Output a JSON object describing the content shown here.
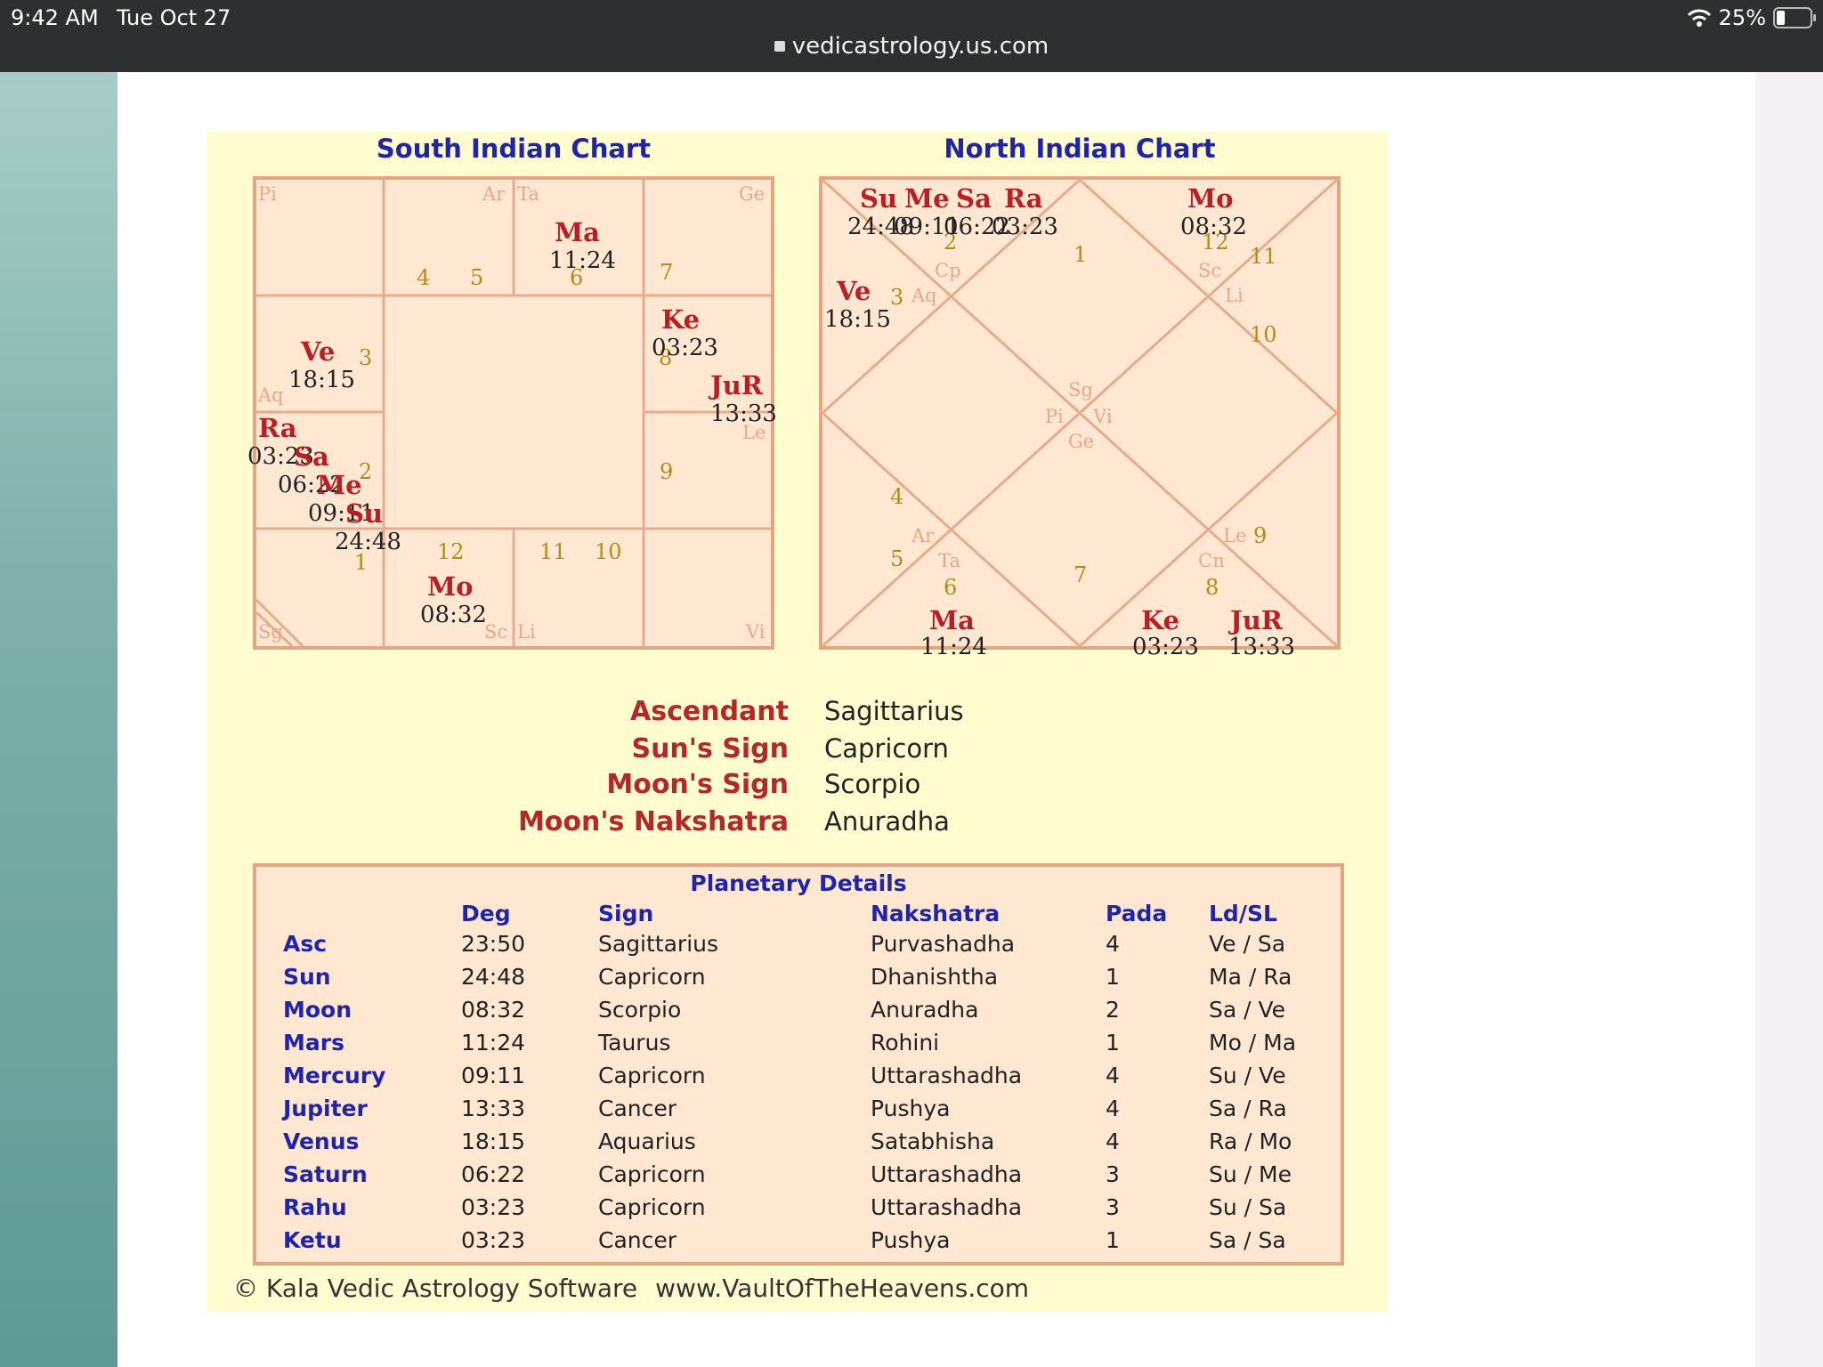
{
  "status_bar": {
    "time": "9:42 AM",
    "date": "Tue Oct 27",
    "battery": "25%",
    "url": "vedicastrology.us.com"
  },
  "south_chart": {
    "title": "South Indian Chart",
    "signs": {
      "pi": "Pi",
      "ar": "Ar",
      "ta": "Ta",
      "ge": "Ge",
      "aq": "Aq",
      "le": "Le",
      "sg": "Sg",
      "sc": "Sc",
      "li": "Li",
      "vi": "Vi"
    },
    "numbers": {
      "n4": "4",
      "n5": "5",
      "n6": "6",
      "n7": "7",
      "n3": "3",
      "n2": "2",
      "n1": "1",
      "n12": "12",
      "n11": "11",
      "n10": "10",
      "n9": "9",
      "n8": "8"
    },
    "planets": {
      "ma": {
        "name": "Ma",
        "deg": "11:24"
      },
      "ke": {
        "name": "Ke",
        "deg": "03:23"
      },
      "jur": {
        "name": "JuR",
        "deg": "13:33"
      },
      "ve": {
        "name": "Ve",
        "deg": "18:15"
      },
      "ra": {
        "name": "Ra",
        "deg": "03:23"
      },
      "sa": {
        "name": "Sa",
        "deg": "06:22"
      },
      "me": {
        "name": "Me",
        "deg": "09:11"
      },
      "su": {
        "name": "Su",
        "deg": "24:48"
      },
      "mo": {
        "name": "Mo",
        "deg": "08:32"
      }
    }
  },
  "north_chart": {
    "title": "North Indian Chart",
    "signs": {
      "cp": "Cp",
      "aq": "Aq",
      "sc": "Sc",
      "li": "Li",
      "sg": "Sg",
      "pi": "Pi",
      "vi": "Vi",
      "ge": "Ge",
      "ar": "Ar",
      "ta": "Ta",
      "le": "Le",
      "cn": "Cn"
    },
    "numbers": {
      "n2": "2",
      "n1": "1",
      "n12": "12",
      "n11": "11",
      "n3": "3",
      "n10": "10",
      "n4": "4",
      "n5": "5",
      "n6": "6",
      "n7": "7",
      "n8": "8",
      "n9": "9"
    },
    "planets": {
      "su": {
        "name": "Su",
        "deg": "24:48"
      },
      "me": {
        "name": "Me",
        "deg": "09:11"
      },
      "sa": {
        "name": "Sa",
        "deg": "06:22"
      },
      "ra": {
        "name": "Ra",
        "deg": "03:23"
      },
      "mo": {
        "name": "Mo",
        "deg": "08:32"
      },
      "ve": {
        "name": "Ve",
        "deg": "18:15"
      },
      "ma": {
        "name": "Ma",
        "deg": "11:24"
      },
      "ke": {
        "name": "Ke",
        "deg": "03:23"
      },
      "jur": {
        "name": "JuR",
        "deg": "13:33"
      }
    }
  },
  "summary": [
    {
      "label": "Ascendant",
      "value": "Sagittarius"
    },
    {
      "label": "Sun's Sign",
      "value": "Capricorn"
    },
    {
      "label": "Moon's Sign",
      "value": "Scorpio"
    },
    {
      "label": "Moon's Nakshatra",
      "value": "Anuradha"
    }
  ],
  "details": {
    "title": "Planetary Details",
    "headers": [
      "Deg",
      "Sign",
      "Nakshatra",
      "Pada",
      "Ld/SL"
    ],
    "rows": [
      [
        "Asc",
        "23:50",
        "Sagittarius",
        "Purvashadha",
        "4",
        "Ve / Sa"
      ],
      [
        "Sun",
        "24:48",
        "Capricorn",
        "Dhanishtha",
        "1",
        "Ma / Ra"
      ],
      [
        "Moon",
        "08:32",
        "Scorpio",
        "Anuradha",
        "2",
        "Sa / Ve"
      ],
      [
        "Mars",
        "11:24",
        "Taurus",
        "Rohini",
        "1",
        "Mo / Ma"
      ],
      [
        "Mercury",
        "09:11",
        "Capricorn",
        "Uttarashadha",
        "4",
        "Su / Ve"
      ],
      [
        "Jupiter",
        "13:33",
        "Cancer",
        "Pushya",
        "4",
        "Sa / Ra"
      ],
      [
        "Venus",
        "18:15",
        "Aquarius",
        "Satabhisha",
        "4",
        "Ra / Mo"
      ],
      [
        "Saturn",
        "06:22",
        "Capricorn",
        "Uttarashadha",
        "3",
        "Su / Me"
      ],
      [
        "Rahu",
        "03:23",
        "Capricorn",
        "Uttarashadha",
        "3",
        "Su / Sa"
      ],
      [
        "Ketu",
        "03:23",
        "Cancer",
        "Pushya",
        "1",
        "Sa / Sa"
      ]
    ]
  },
  "footer": {
    "copyright": "© Kala Vedic Astrology Software",
    "site": "www.VaultOfTheHeavens.com"
  },
  "colors": {
    "chart_fill": "#ffe7d2",
    "chart_line": "#e4a582",
    "report_bg": "#fffdd0",
    "planet": "#b82025",
    "heading": "#1f24a8",
    "house_number": "#b68a18"
  }
}
